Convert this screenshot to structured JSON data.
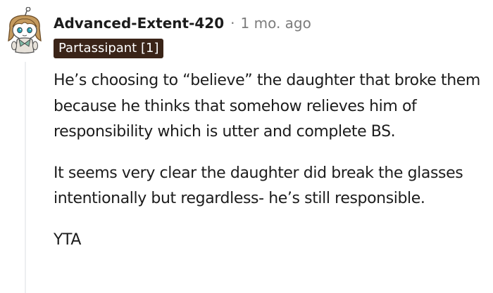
{
  "comment": {
    "username": "Advanced-Extent-420",
    "separator": "·",
    "timestamp": "1 mo. ago",
    "flair": "Partassipant [1]",
    "paragraphs": [
      "He’s choosing to “believe” the daughter that broke them because he thinks that somehow relieves him of responsibility which is utter and complete BS.",
      "It seems very clear the daughter did break the glasses intentionally but regardless- he’s still responsible.",
      "YTA"
    ],
    "icons": {
      "avatar": "snoo-avatar-icon"
    },
    "colors": {
      "flair_background": "#3a2418",
      "timestamp": "#7c7c7c",
      "thread_line": "#edeff1"
    }
  }
}
